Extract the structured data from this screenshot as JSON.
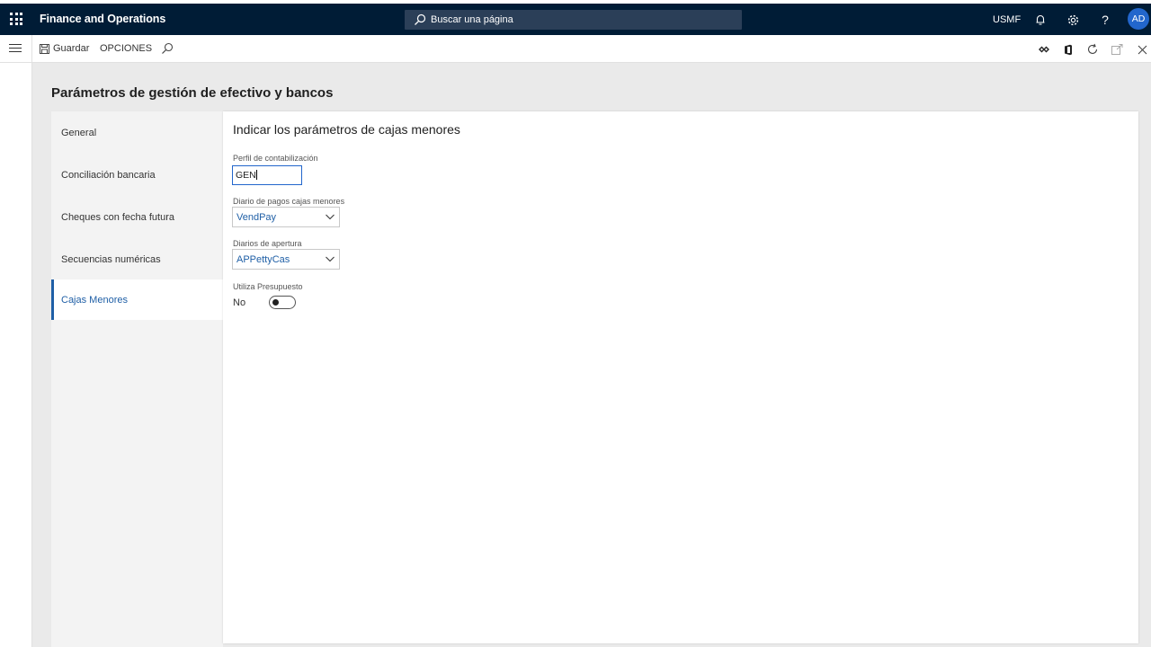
{
  "topbar": {
    "app_title": "Finance and Operations",
    "search_placeholder": "Buscar una página",
    "company": "USMF",
    "help_label": "?",
    "avatar_initials": "AD"
  },
  "actionbar": {
    "save_label": "Guardar",
    "options_label": "OPCIONES"
  },
  "page": {
    "title": "Parámetros de gestión de efectivo y bancos"
  },
  "sidenav": {
    "items": [
      {
        "label": "General"
      },
      {
        "label": "Conciliación bancaria"
      },
      {
        "label": "Cheques con fecha futura"
      },
      {
        "label": "Secuencias numéricas"
      },
      {
        "label": "Cajas Menores"
      }
    ],
    "active_index": 4
  },
  "panel": {
    "title": "Indicar los parámetros de cajas menores",
    "posting_profile": {
      "label": "Perfil de contabilización",
      "value": "GEN"
    },
    "petty_cash_journal": {
      "label": "Diario de pagos cajas menores",
      "value": "VendPay"
    },
    "opening_journal": {
      "label": "Diarios de apertura",
      "value": "APPettyCas"
    },
    "use_budget": {
      "label": "Utiliza Presupuesto",
      "value": "No"
    }
  },
  "colors": {
    "topbar_bg": "#001c36",
    "accent": "#1f5fa6",
    "avatar_bg": "#2266cc"
  }
}
